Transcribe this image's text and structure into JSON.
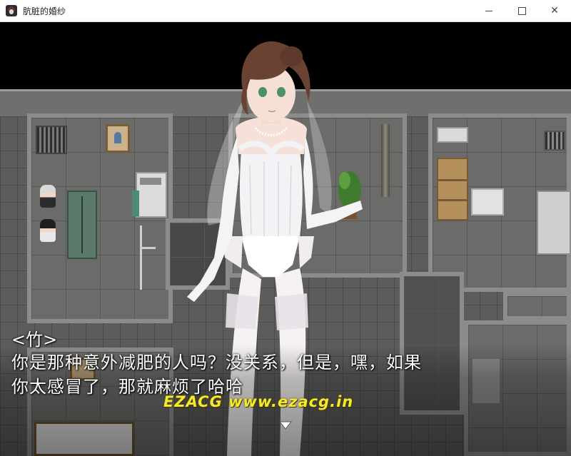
{
  "window": {
    "title": "肮脏的婚纱",
    "icon": "app-icon",
    "controls": {
      "minimize": "minimize-icon",
      "maximize": "maximize-icon",
      "close": "close-icon",
      "close_glyph": "✕"
    }
  },
  "scene": {
    "character": "bride-standing-figure",
    "location": "facility-map"
  },
  "dialogue": {
    "speaker": "<竹>",
    "lines": [
      "你是那种意外减肥的人吗？没关系，但是，嘿，如果",
      "你太感冒了，那就麻烦了哈哈"
    ],
    "continue_icon": "down-triangle-icon"
  },
  "watermark": "EZACG www.ezacg.in",
  "colors": {
    "watermark": "#f2ea30",
    "text": "#ffffff",
    "titlebar": "#ffffff"
  }
}
